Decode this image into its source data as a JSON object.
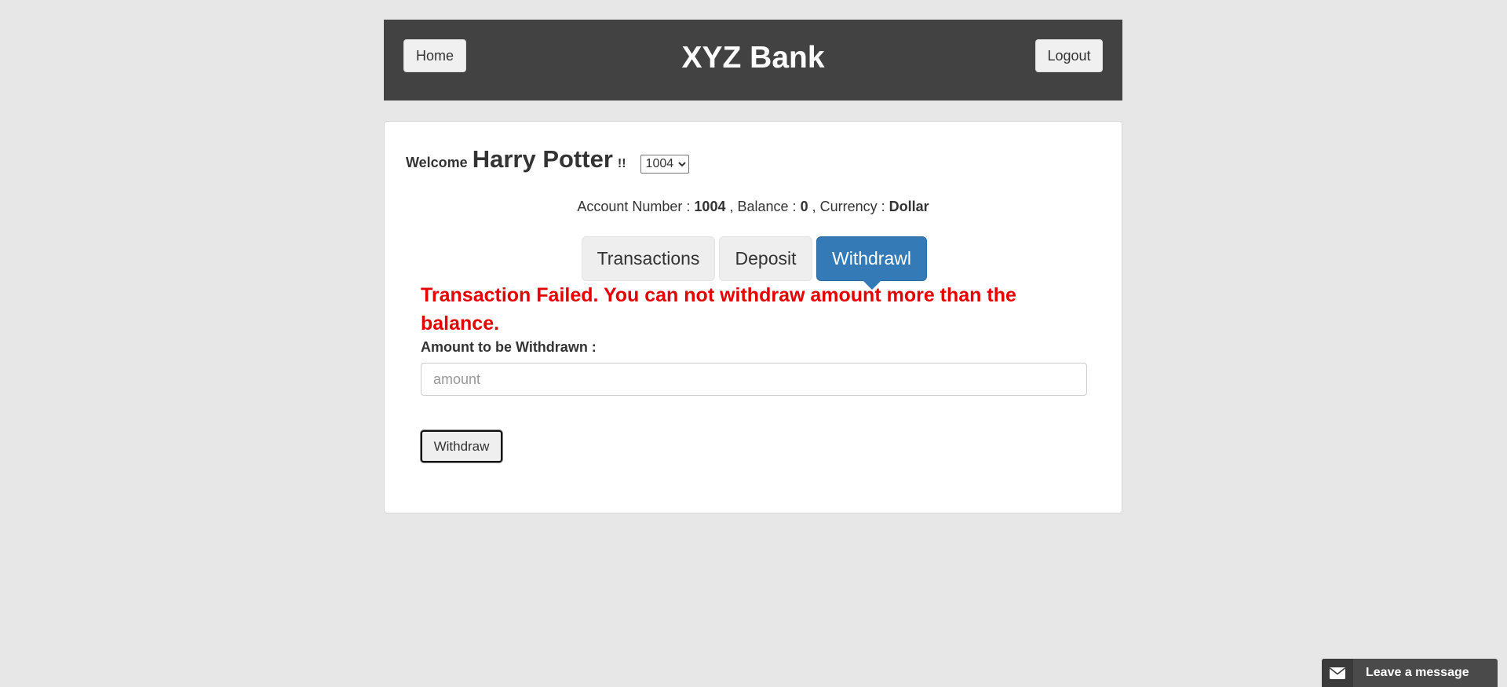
{
  "header": {
    "home_label": "Home",
    "title": "XYZ Bank",
    "logout_label": "Logout"
  },
  "customer": {
    "welcome": "Welcome",
    "name": "Harry Potter",
    "exclaim": "!!",
    "selected_account": "1004"
  },
  "account_info": {
    "number_label": "Account Number :",
    "number": "1004",
    "balance_label": ", Balance :",
    "balance": "0",
    "currency_label": ", Currency :",
    "currency": "Dollar"
  },
  "tabs": [
    {
      "label": "Transactions",
      "active": false
    },
    {
      "label": "Deposit",
      "active": false
    },
    {
      "label": "Withdrawl",
      "active": true
    }
  ],
  "withdraw_form": {
    "error_message": "Transaction Failed. You can not withdraw amount more than the balance.",
    "amount_label": "Amount to be Withdrawn :",
    "amount_placeholder": "amount",
    "amount_value": "",
    "submit_label": "Withdraw"
  },
  "chat": {
    "label": "Leave a message",
    "icon": "envelope-icon"
  },
  "colors": {
    "header_bg": "#424242",
    "active_tab": "#337ab7",
    "error": "#e60000",
    "page_bg": "#e7e7e7"
  }
}
